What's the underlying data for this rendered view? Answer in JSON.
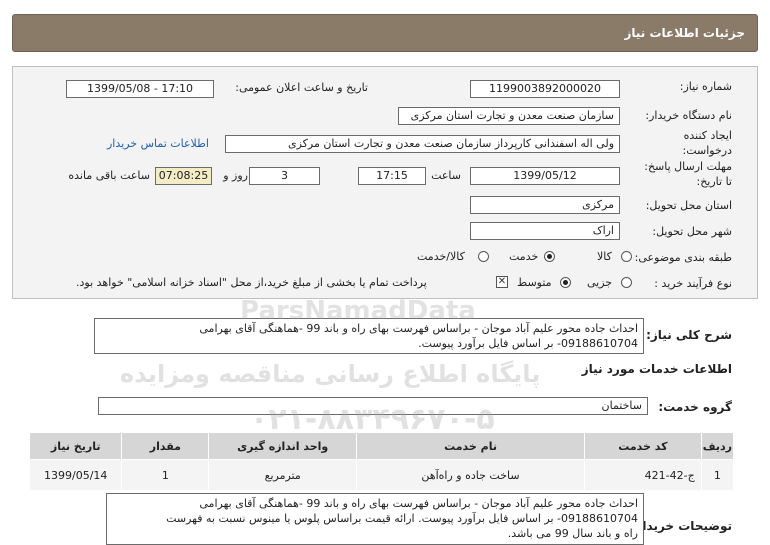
{
  "page": {
    "title": "جزئیات اطلاعات نیاز"
  },
  "fields": {
    "need_number_label": "شماره نیاز:",
    "need_number": "1199003892000020",
    "announce_label": "تاریخ و ساعت اعلان عمومی:",
    "announce_value": "1399/05/08 - 17:10",
    "buyer_label": "نام دستگاه خریدار:",
    "buyer": "سازمان صنعت معدن و تجارت استان مرکزی",
    "creator_label_1": "ایجاد کننده",
    "creator_label_2": "درخواست:",
    "creator": "ولی اله اسفندانی کارپرداز سازمان صنعت معدن و تجارت استان مرکزی",
    "contact_link": "اطلاعات تماس خریدار",
    "deadline_label_1": "مهلت ارسال پاسخ:",
    "deadline_label_2": "تا تاریخ:",
    "deadline_date": "1399/05/12",
    "time_label": "ساعت",
    "deadline_time": "17:15",
    "days_value": "3",
    "days_label": "روز و",
    "remaining_time": "07:08:25",
    "remaining_label": "ساعت باقی مانده",
    "province_label": "استان محل تحویل:",
    "province": "مرکزی",
    "city_label": "شهر محل تحویل:",
    "city": "اراک",
    "category_label": "طبقه بندی موضوعی:",
    "category_options": [
      "کالا",
      "خدمت",
      "کالا/خدمت"
    ],
    "category_selected": "خدمت",
    "process_label": "نوع فرآیند خرید :",
    "process_options": [
      "جزیی",
      "متوسط"
    ],
    "process_selected": "متوسط",
    "payment_checkbox_label": "پرداخت تمام یا بخشی از مبلغ خرید،از محل \"اسناد خزانه اسلامی\" خواهد بود."
  },
  "summary": {
    "label": "شرح کلی نیاز:",
    "line1": "احداث جاده محور علیم آباد موجان - براساس فهرست بهای راه و باند 99 -هماهنگی آقای بهرامی",
    "line2": "09188610704- بر اساس فایل برآورد پیوست."
  },
  "services": {
    "heading": "اطلاعات خدمات مورد نیاز",
    "group_label": "گروه خدمت:",
    "group_value": "ساختمان",
    "columns": [
      "ردیف",
      "کد خدمت",
      "نام خدمت",
      "واحد اندازه گیری",
      "مقدار",
      "تاریخ نیاز"
    ],
    "rows": [
      {
        "index": "1",
        "code": "ج-42-421",
        "name": "ساخت جاده و راه‌آهن",
        "unit": "مترمربع",
        "qty": "1",
        "date": "1399/05/14"
      }
    ]
  },
  "buyer_notes": {
    "label": "توضیحات خریدار:",
    "line1": "احداث جاده محور علیم آباد موجان - براساس فهرست بهای راه و باند 99 -هماهنگی آقای بهرامی",
    "line2": "09188610704- بر اساس فایل برآورد پیوست. ارائه قیمت براساس پلوس یا مینوس نسبت به فهرست",
    "line3": "راه و باند سال 99 می باشد."
  },
  "watermark": {
    "brand": "ParsNamadData",
    "line1": "پایگاه اطلاع رسانی مناقصه ومزایده",
    "line2": "۰۲۱-۸۸۳۴۹۶۷۰-۵"
  }
}
